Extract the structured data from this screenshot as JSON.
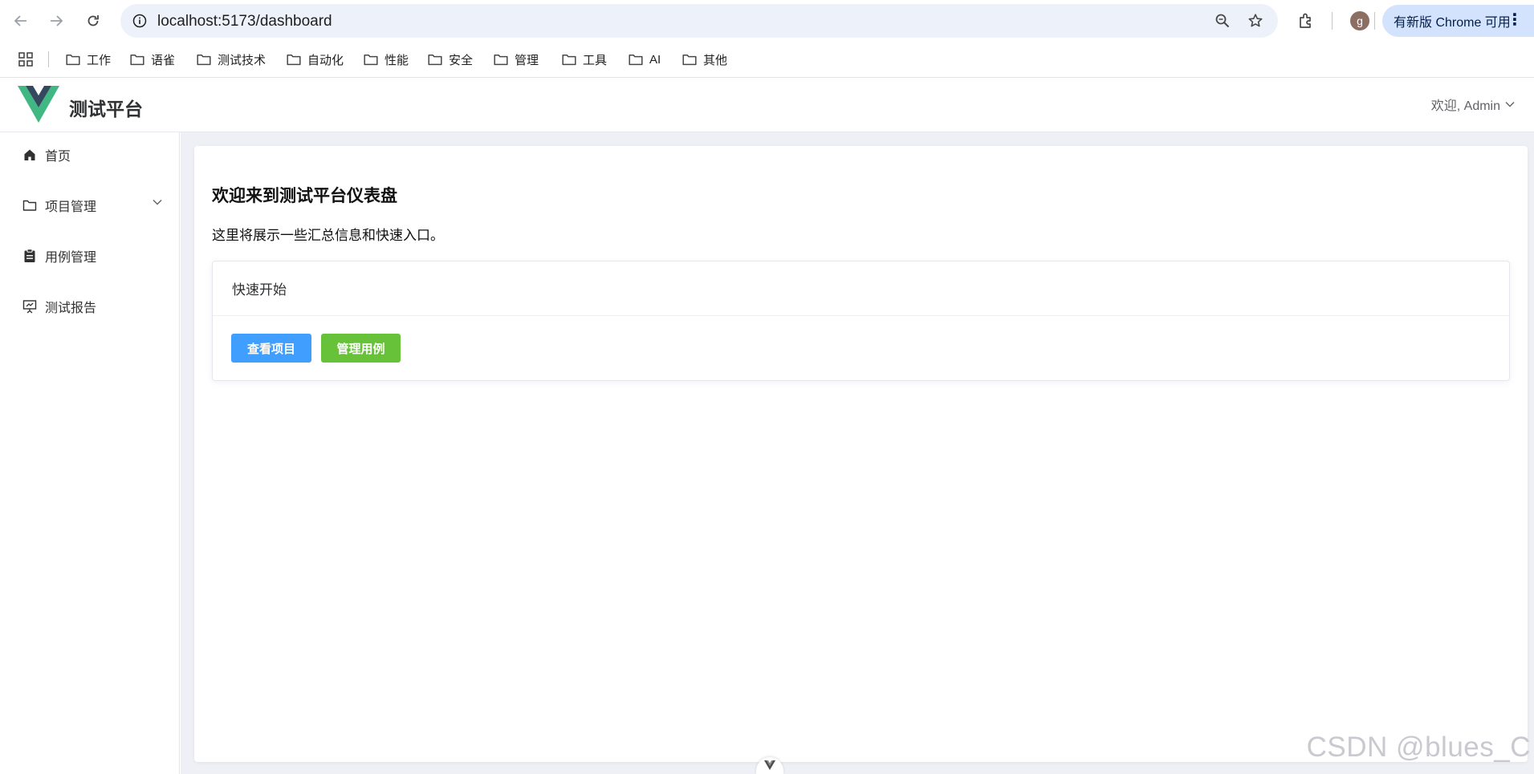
{
  "browser": {
    "url_host": "localhost",
    "url_path": ":5173/dashboard",
    "update_label": "有新版 Chrome 可用",
    "avatar_letter": "g"
  },
  "bookmarks": [
    "工作",
    "语雀",
    "测试技术",
    "自动化",
    "性能",
    "安全",
    "管理",
    "工具",
    "AI",
    "其他"
  ],
  "header": {
    "title": "测试平台",
    "user_greeting": "欢迎, Admin"
  },
  "sidebar": {
    "items": [
      {
        "label": "首页",
        "icon": "home-icon"
      },
      {
        "label": "项目管理",
        "icon": "folder-icon"
      },
      {
        "label": "用例管理",
        "icon": "clipboard-icon"
      },
      {
        "label": "测试报告",
        "icon": "presentation-icon"
      }
    ]
  },
  "main": {
    "title": "欢迎来到测试平台仪表盘",
    "subtitle": "这里将展示一些汇总信息和快速入口。",
    "quick_start": {
      "title": "快速开始",
      "view_projects": "查看项目",
      "manage_cases": "管理用例"
    }
  },
  "watermark": "CSDN @blues_C",
  "colors": {
    "primary": "#409eff",
    "success": "#67c23a",
    "vue_green": "#41b883",
    "vue_dark": "#35495e"
  }
}
